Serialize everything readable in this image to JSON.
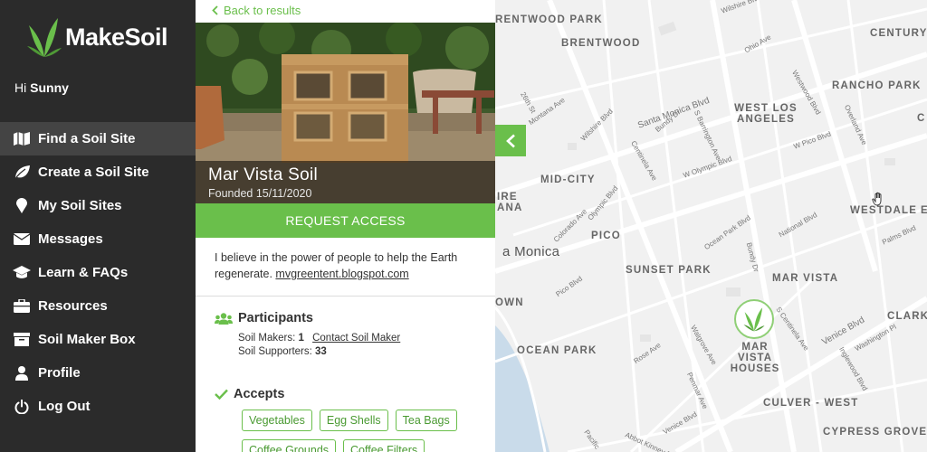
{
  "brand": {
    "name": "MakeSoil",
    "accent": "#6abf4b"
  },
  "greeting": {
    "prefix": "Hi",
    "user": "Sunny"
  },
  "nav": [
    {
      "label": "Find a Soil Site",
      "icon": "map-icon",
      "active": true
    },
    {
      "label": "Create a Soil Site",
      "icon": "leaf-icon"
    },
    {
      "label": "My Soil Sites",
      "icon": "pin-icon"
    },
    {
      "label": "Messages",
      "icon": "envelope-icon"
    },
    {
      "label": "Learn & FAQs",
      "icon": "graduation-cap-icon"
    },
    {
      "label": "Resources",
      "icon": "briefcase-icon"
    },
    {
      "label": "Soil Maker Box",
      "icon": "archive-box-icon"
    },
    {
      "label": "Profile",
      "icon": "user-icon"
    },
    {
      "label": "Log Out",
      "icon": "power-icon"
    }
  ],
  "site": {
    "back_label": "Back to results",
    "name": "Mar Vista Soil",
    "founded": "Founded 15/11/2020",
    "request_label": "REQUEST ACCESS",
    "about": "I believe in the power of people to help the Earth regenerate.",
    "about_link": "mvgreentent.blogspot.com",
    "participants_title": "Participants",
    "makers_label": "Soil Makers:",
    "makers_count": "1",
    "contact_label": "Contact Soil Maker",
    "supporters_label": "Soil Supporters:",
    "supporters_count": "33",
    "accepts_title": "Accepts",
    "accepts": [
      "Vegetables",
      "Egg Shells",
      "Tea Bags",
      "Coffee Grounds",
      "Coffee Filters"
    ]
  },
  "map": {
    "marker_label": "MAR VISTA HOUSES",
    "areas": [
      "RENTWOOD PARK",
      "BRENTWOOD",
      "CENTURY",
      "RANCHO PARK",
      "WEST LOS ANGELES",
      "MID-CITY",
      "IRE",
      "ANA",
      "WESTDALE",
      "PICO",
      "a Monica",
      "SUNSET PARK",
      "MAR VISTA",
      "CLARK",
      "OWN",
      "OCEAN PARK",
      "CULVER - WEST",
      "CYPRESS GROVE",
      "C",
      "E"
    ],
    "roads": [
      "Wilshire Blvd",
      "Ohio Ave",
      "Westwood Blvd",
      "Overland Ave",
      "26th St",
      "Montana Ave",
      "Santa Monica Blvd",
      "S Barrington Ave",
      "Bundy Dr",
      "Wilshire Blvd",
      "W Pico Blvd",
      "Centinela Ave",
      "W Olympic Blvd",
      "Olympic Blvd",
      "Colorado Ave",
      "Ocean Park Blvd",
      "National Blvd",
      "Palms Blvd",
      "Bundy Dr",
      "Pico Blvd",
      "S Centinela Ave",
      "Venice Blvd",
      "Washington Pl",
      "Inglewood Blvd",
      "Walgrove Ave",
      "Rose Ave",
      "Penmar Ave",
      "Pacific",
      "Abbot Kinney Blvd",
      "Venice Blvd"
    ]
  }
}
